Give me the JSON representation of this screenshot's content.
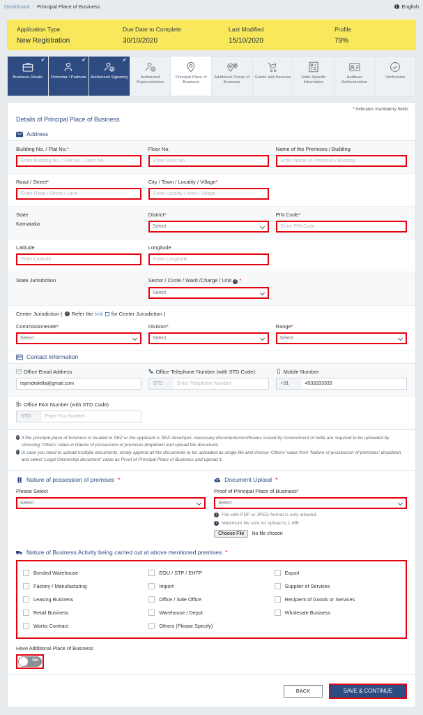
{
  "breadcrumb": {
    "home": "Dashboard",
    "separator": "›",
    "current": "Principal Place of Business"
  },
  "language": {
    "label": "English"
  },
  "summary": [
    {
      "label": "Application Type",
      "value": "New Registration"
    },
    {
      "label": "Due Date to Complete",
      "value": "30/10/2020"
    },
    {
      "label": "Last Modified",
      "value": "15/10/2020"
    },
    {
      "label": "Profile",
      "value": "79%"
    }
  ],
  "tabs": [
    {
      "label": "Business Details",
      "state": "done",
      "icon": "briefcase-icon",
      "check": "✔"
    },
    {
      "label": "Promoter / Partners",
      "state": "done",
      "icon": "person-icon",
      "check": "✔"
    },
    {
      "label": "Authorized Signatory",
      "state": "done",
      "icon": "person-signature-icon",
      "check": "✔"
    },
    {
      "label": "Authorized Representative",
      "state": "idle",
      "icon": "person-check-icon",
      "check": ""
    },
    {
      "label": "Principal Place of Business",
      "state": "active",
      "icon": "map-pin-icon",
      "check": ""
    },
    {
      "label": "Additional Places of Business",
      "state": "idle",
      "icon": "map-pins-icon",
      "check": ""
    },
    {
      "label": "Goods and Services",
      "state": "idle",
      "icon": "cart-icon",
      "check": ""
    },
    {
      "label": "State Specific Information",
      "state": "idle",
      "icon": "document-list-icon",
      "check": ""
    },
    {
      "label": "Aadhaar Authentication",
      "state": "idle",
      "icon": "id-card-icon",
      "check": ""
    },
    {
      "label": "Verification",
      "state": "idle",
      "icon": "check-circle-icon",
      "check": ""
    }
  ],
  "mandatory_note": "indicates mandatory fields",
  "panel_title": "Details of Principal Place of Business",
  "address": {
    "heading": "Address",
    "building_no": {
      "label": "Building No. / Flat No.",
      "placeholder": "Enter Building No. / Flat No. / Door No.",
      "value": ""
    },
    "floor_no": {
      "label": "Floor No.",
      "placeholder": "Enter Floor No.",
      "value": ""
    },
    "premises_name": {
      "label": "Name of the Premises / Building",
      "placeholder": "Enter Name of Premises / Building",
      "value": ""
    },
    "road_street": {
      "label": "Road / Street",
      "placeholder": "Enter Road / Street / Lane",
      "value": ""
    },
    "city": {
      "label": "City / Town / Locality / Village",
      "placeholder": "Enter Locality / Area / Village",
      "value": ""
    },
    "state": {
      "label": "State",
      "value": "Karnataka"
    },
    "district": {
      "label": "District",
      "value": "Select"
    },
    "pin_code": {
      "label": "PIN Code",
      "placeholder": "Enter PIN Code",
      "value": ""
    },
    "latitude": {
      "label": "Latitude",
      "placeholder": "Enter Latitude",
      "value": ""
    },
    "longitude": {
      "label": "Longitude",
      "placeholder": "Enter Longitude",
      "value": ""
    },
    "state_jurisdiction": {
      "label": "State Jurisdiction"
    },
    "sector": {
      "label": "Sector / Circle / Ward /Charge / Unit",
      "value": "Select"
    }
  },
  "center_jurisdiction": {
    "prefix": "Center Jurisdiction (",
    "refer": "Refer the",
    "link": "link",
    "suffix": "for Center Jurisdiction )",
    "commissionerate": {
      "label": "Commissionerate",
      "value": "Select"
    },
    "division": {
      "label": "Division",
      "value": "Select"
    },
    "range": {
      "label": "Range",
      "value": "Select"
    }
  },
  "contact": {
    "heading": "Contact Information",
    "email": {
      "label": "Office Email Address",
      "value": "rajendralella@gmail.com",
      "icon": "envelope-icon"
    },
    "telephone": {
      "label": "Office Telephone Number (with STD Code)",
      "std_placeholder": "STD",
      "placeholder": "Enter Telephone Number",
      "value": "",
      "icon": "phone-icon"
    },
    "mobile": {
      "label": "Mobile Number",
      "prefix": "+91",
      "value": "4533333333",
      "icon": "mobile-icon"
    },
    "fax": {
      "label": "Office FAX Number (with STD Code)",
      "std_placeholder": "STD",
      "placeholder": "Enter Fax Number",
      "value": "",
      "icon": "fax-icon"
    }
  },
  "notes": [
    "If the principal place of business is located in SEZ or the applicant is SEZ developer, necessary documents/certificates issued by Government of India are required to be uploaded by choosing 'Others' value in Nature of possession of premises dropdown and upload the document.",
    "In case you need to upload multiple documents, kindly append all the documents to be uploaded as single file and choose 'Others' value from 'Nature of possession of premises' dropdown and select 'Legal Ownership document' value as Proof of Principal Place of Business and upload it."
  ],
  "possession": {
    "heading": "Nature of possession of premises",
    "sub_label": "Please Select",
    "value": "Select"
  },
  "document_upload": {
    "heading": "Document Upload",
    "proof_label": "Proof of Principal Place of Business",
    "proof_value": "Select",
    "hint_format": "File with PDF or JPEG format is only allowed.",
    "hint_size": "Maximum file size for upload is 1 MB",
    "choose_button": "Choose File",
    "file_status": "No file chosen"
  },
  "business_activity": {
    "heading": "Nature of Business Activity being carried out at above mentioned premises",
    "options": [
      "Bonded Warehouse",
      "EOU / STP / EHTP",
      "Export",
      "Factory / Manufacturing",
      "Import",
      "Supplier of Services",
      "Leasing Business",
      "Office / Sale Office",
      "Recipient of Goods or Services",
      "Retail Business",
      "Warehouse / Depot",
      "Wholesale Business",
      "Works Contract",
      "Others (Please Specify)"
    ]
  },
  "additional_place": {
    "label": "Have Additional Place of Business",
    "toggle_value": "No"
  },
  "footer": {
    "back": "BACK",
    "save": "SAVE & CONTINUE"
  },
  "colors": {
    "brand": "#2e4b82",
    "error": "#e3000f",
    "summary_bg": "#f9e85c",
    "link": "#4a7fc1"
  }
}
